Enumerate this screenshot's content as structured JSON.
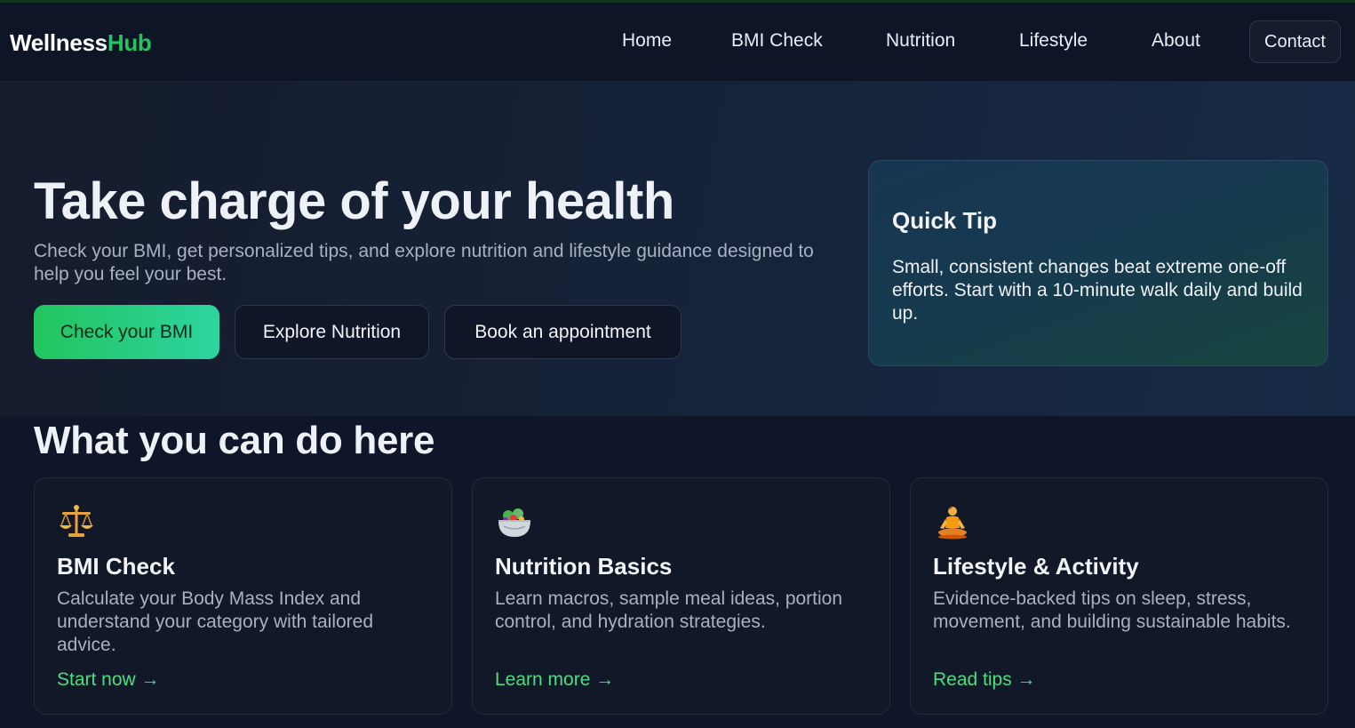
{
  "brand": {
    "part1": "Wellness",
    "part2": "Hub"
  },
  "nav": {
    "items": [
      "Home",
      "BMI Check",
      "Nutrition",
      "Lifestyle",
      "About"
    ],
    "contact": "Contact"
  },
  "hero": {
    "title": "Take charge of your health",
    "subtitle": "Check your BMI, get personalized tips, and explore nutrition and lifestyle guidance designed to help you feel your best.",
    "buttons": [
      "Check your BMI",
      "Explore Nutrition",
      "Book an appointment"
    ]
  },
  "tip": {
    "title": "Quick Tip",
    "body": "Small, consistent changes beat extreme one-off efforts. Start with a 10-minute walk daily and build up."
  },
  "features": {
    "title": "What you can do here",
    "cards": [
      {
        "icon": "balance-scale-icon",
        "title": "BMI Check",
        "desc": "Calculate your Body Mass Index and understand your category with tailored advice.",
        "link": "Start now →"
      },
      {
        "icon": "salad-bowl-icon",
        "title": "Nutrition Basics",
        "desc": "Learn macros, sample meal ideas, portion control, and hydration strategies.",
        "link": "Learn more →"
      },
      {
        "icon": "meditation-person-icon",
        "title": "Lifestyle & Activity",
        "desc": "Evidence-backed tips on sleep, stress, movement, and building sustainable habits.",
        "link": "Read tips →"
      }
    ]
  },
  "colors": {
    "accent": "#22c55e",
    "link": "#4ade80",
    "background": "#0f1629"
  }
}
